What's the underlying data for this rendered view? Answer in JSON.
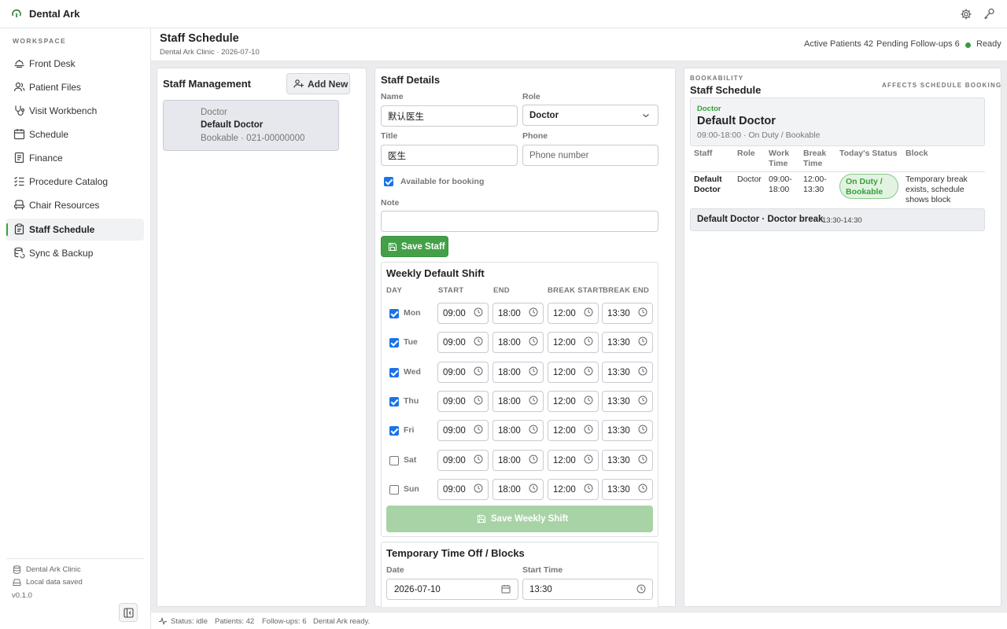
{
  "app": {
    "name": "Dental Ark"
  },
  "sidebar": {
    "section": "WORKSPACE",
    "items": [
      {
        "label": "Front Desk",
        "icon": "monitor-icon"
      },
      {
        "label": "Patient Files",
        "icon": "users-icon"
      },
      {
        "label": "Visit Workbench",
        "icon": "stethoscope-icon"
      },
      {
        "label": "Schedule",
        "icon": "calendar-icon"
      },
      {
        "label": "Finance",
        "icon": "receipt-icon"
      },
      {
        "label": "Procedure Catalog",
        "icon": "list-check-icon"
      },
      {
        "label": "Chair Resources",
        "icon": "chair-icon"
      },
      {
        "label": "Staff Schedule",
        "icon": "clipboard-icon",
        "active": true
      },
      {
        "label": "Sync & Backup",
        "icon": "database-sync-icon"
      }
    ],
    "footer": {
      "clinic": "Dental Ark Clinic",
      "saved": "Local data saved",
      "version": "v0.1.0"
    }
  },
  "header": {
    "title": "Staff Schedule",
    "subtitle": "Dental Ark Clinic · 2026-07-10",
    "active_patients": "Active Patients 42",
    "pending_followups": "Pending Follow-ups 6",
    "status": "Ready"
  },
  "staff_management": {
    "title": "Staff Management",
    "add_label": "Add New",
    "staff": [
      {
        "role": "Doctor",
        "name": "Default Doctor",
        "detail": "Bookable · 021-00000000"
      }
    ]
  },
  "staff_details": {
    "title": "Staff Details",
    "name_label": "Name",
    "name_value": "默认医生",
    "role_label": "Role",
    "role_value": "Doctor",
    "title_label": "Title",
    "title_value": "医生",
    "phone_label": "Phone",
    "phone_placeholder": "Phone number",
    "available_label": "Available for booking",
    "available": true,
    "note_label": "Note",
    "note_value": "",
    "save_label": "Save Staff"
  },
  "weekly_shift": {
    "title": "Weekly Default Shift",
    "columns": [
      "DAY",
      "START",
      "END",
      "BREAK START",
      "BREAK END"
    ],
    "days": [
      {
        "day": "Mon",
        "enabled": true,
        "start": "09:00",
        "end": "18:00",
        "break_start": "12:00",
        "break_end": "13:30"
      },
      {
        "day": "Tue",
        "enabled": true,
        "start": "09:00",
        "end": "18:00",
        "break_start": "12:00",
        "break_end": "13:30"
      },
      {
        "day": "Wed",
        "enabled": true,
        "start": "09:00",
        "end": "18:00",
        "break_start": "12:00",
        "break_end": "13:30"
      },
      {
        "day": "Thu",
        "enabled": true,
        "start": "09:00",
        "end": "18:00",
        "break_start": "12:00",
        "break_end": "13:30"
      },
      {
        "day": "Fri",
        "enabled": true,
        "start": "09:00",
        "end": "18:00",
        "break_start": "12:00",
        "break_end": "13:30"
      },
      {
        "day": "Sat",
        "enabled": false,
        "start": "09:00",
        "end": "18:00",
        "break_start": "12:00",
        "break_end": "13:30"
      },
      {
        "day": "Sun",
        "enabled": false,
        "start": "09:00",
        "end": "18:00",
        "break_start": "12:00",
        "break_end": "13:30"
      }
    ],
    "save_label": "Save Weekly Shift"
  },
  "time_off": {
    "title": "Temporary Time Off / Blocks",
    "date_label": "Date",
    "date_value": "2026-07-10",
    "start_label": "Start Time",
    "start_value": "13:30"
  },
  "bookability": {
    "kicker": "BOOKABILITY",
    "title": "Staff Schedule",
    "note": "AFFECTS SCHEDULE BOOKING",
    "summary": {
      "role": "Doctor",
      "name": "Default Doctor",
      "info": "09:00-18:00 · On Duty / Bookable"
    },
    "columns": {
      "staff": "Staff",
      "role": "Role",
      "work1": "Work",
      "work2": "Time",
      "break1": "Break",
      "break2": "Time",
      "status": "Today's Status",
      "block": "Block"
    },
    "row": {
      "staff1": "Default",
      "staff2": "Doctor",
      "role": "Doctor",
      "work1": "09:00-",
      "work2": "18:00",
      "break1": "12:00-",
      "break2": "13:30",
      "status1": "On Duty /",
      "status2": "Bookable",
      "block1": "Temporary break",
      "block2": "exists, schedule",
      "block3": "shows block"
    },
    "block_entry": {
      "title": "Default Doctor · Doctor break",
      "time": "13:30-14:30"
    }
  },
  "statusbar": {
    "status": "Status: idle",
    "patients": "Patients: 42",
    "followups": "Follow-ups: 6",
    "message": "Dental Ark ready."
  },
  "colors": {
    "accent": "#43a047",
    "accent_light": "#a8d3a6",
    "checkbox": "#1a73e8",
    "pill_bg": "#e3f3e2"
  }
}
